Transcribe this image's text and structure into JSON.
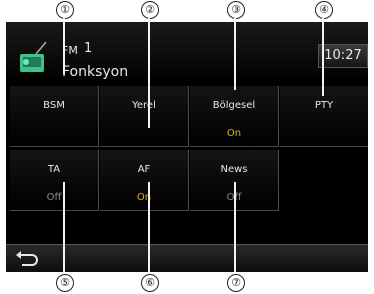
{
  "header": {
    "band": "FM",
    "preset": "1",
    "mode": "Fonksyon",
    "clock": "10:27"
  },
  "keys": [
    {
      "label": "BSM",
      "state": ""
    },
    {
      "label": "Yerel",
      "state": ""
    },
    {
      "label": "Bölgesel",
      "state": "On"
    },
    {
      "label": "PTY",
      "state": ""
    },
    {
      "label": "TA",
      "state": "Off"
    },
    {
      "label": "AF",
      "state": "On"
    },
    {
      "label": "News",
      "state": "Off"
    }
  ],
  "callouts": [
    "①",
    "②",
    "③",
    "④",
    "⑤",
    "⑥",
    "⑦"
  ],
  "colors": {
    "on": "#e6b400",
    "off": "#8a8a8a",
    "background": "#000000"
  },
  "icons": {
    "back": "back-arrow-icon",
    "radio": "fm-radio-icon"
  }
}
